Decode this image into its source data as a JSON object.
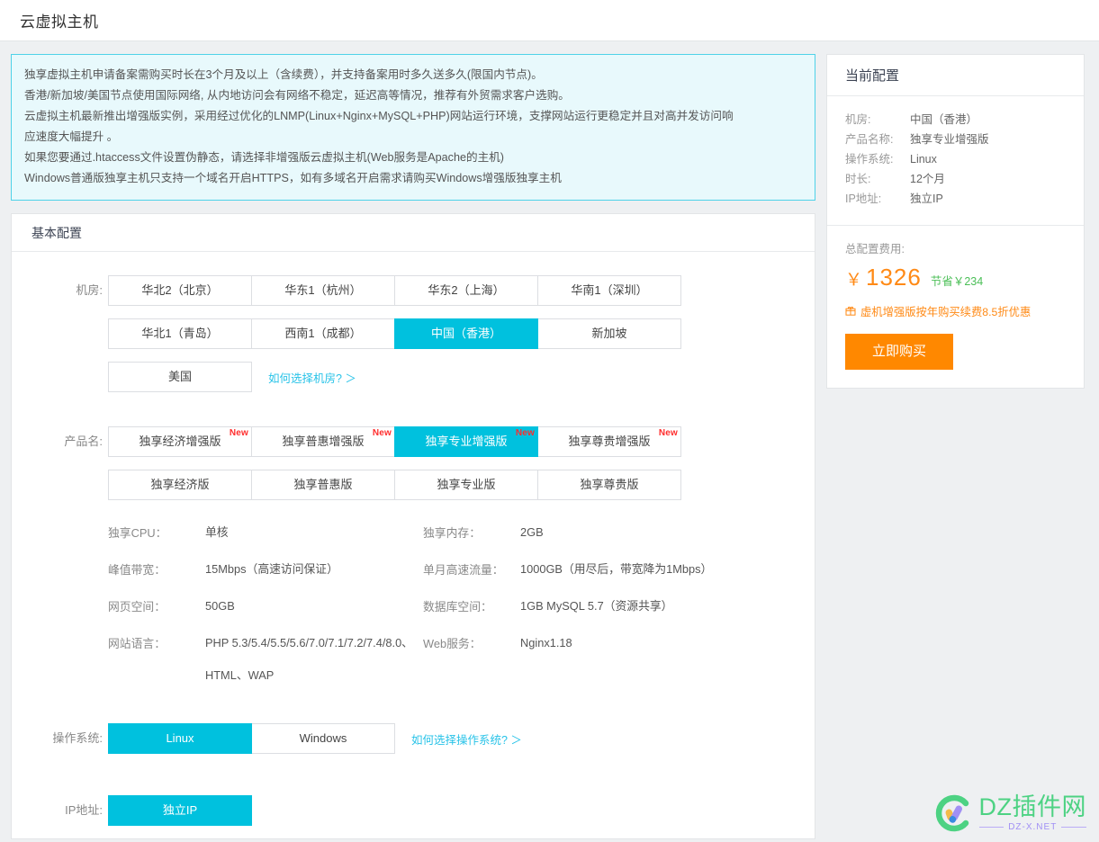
{
  "header": {
    "title": "云虚拟主机"
  },
  "notice": {
    "lines": [
      "独享虚拟主机申请备案需购买时长在3个月及以上（含续费），并支持备案用时多久送多久(限国内节点)。",
      "香港/新加坡/美国节点使用国际网络, 从内地访问会有网络不稳定，延迟高等情况，推荐有外贸需求客户选购。",
      "云虚拟主机最新推出增强版实例，采用经过优化的LNMP(Linux+Nginx+MySQL+PHP)网站运行环境，支撑网站运行更稳定并且对高并发访问响",
      "应速度大幅提升 。",
      "如果您要通过.htaccess文件设置伪静态，请选择非增强版云虚拟主机(Web服务是Apache的主机)",
      "Windows普通版独享主机只支持一个域名开启HTTPS，如有多域名开启需求请购买Windows增强版独享主机"
    ]
  },
  "basic_config": {
    "section_title": "基本配置",
    "room": {
      "label": "机房:",
      "rows": [
        [
          {
            "text": "华北2（北京）",
            "selected": false
          },
          {
            "text": "华东1（杭州）",
            "selected": false
          },
          {
            "text": "华东2（上海）",
            "selected": false
          },
          {
            "text": "华南1（深圳）",
            "selected": false
          }
        ],
        [
          {
            "text": "华北1（青岛）",
            "selected": false
          },
          {
            "text": "西南1（成都）",
            "selected": false
          },
          {
            "text": "中国（香港）",
            "selected": true
          },
          {
            "text": "新加坡",
            "selected": false
          }
        ],
        [
          {
            "text": "美国",
            "selected": false
          }
        ]
      ],
      "help_link": "如何选择机房? ＞"
    },
    "product": {
      "label": "产品名:",
      "badge_text": "New",
      "rows": [
        [
          {
            "text": "独享经济增强版",
            "selected": false,
            "badge": true
          },
          {
            "text": "独享普惠增强版",
            "selected": false,
            "badge": true
          },
          {
            "text": "独享专业增强版",
            "selected": true,
            "badge": true
          },
          {
            "text": "独享尊贵增强版",
            "selected": false,
            "badge": true
          }
        ],
        [
          {
            "text": "独享经济版",
            "selected": false,
            "badge": false
          },
          {
            "text": "独享普惠版",
            "selected": false,
            "badge": false
          },
          {
            "text": "独享专业版",
            "selected": false,
            "badge": false
          },
          {
            "text": "独享尊贵版",
            "selected": false,
            "badge": false
          }
        ]
      ]
    },
    "specs_left": [
      {
        "key": "独享CPU：",
        "value": "单核"
      },
      {
        "key": "峰值带宽：",
        "value": "15Mbps（高速访问保证）"
      },
      {
        "key": "网页空间：",
        "value": "50GB"
      },
      {
        "key": "网站语言：",
        "value": "PHP 5.3/5.4/5.5/5.6/7.0/7.1/7.2/7.4/8.0、",
        "value2": "HTML、WAP"
      }
    ],
    "specs_right": [
      {
        "key": "独享内存：",
        "value": "2GB"
      },
      {
        "key": "单月高速流量：",
        "value": "1000GB（用尽后，带宽降为1Mbps）"
      },
      {
        "key": "数据库空间：",
        "value": "1GB MySQL 5.7（资源共享）"
      },
      {
        "key": "Web服务：",
        "value": "Nginx1.18"
      }
    ],
    "os": {
      "label": "操作系统:",
      "options": [
        {
          "text": "Linux",
          "selected": true
        },
        {
          "text": "Windows",
          "selected": false
        }
      ],
      "help_link": "如何选择操作系统? ＞"
    },
    "ip": {
      "label": "IP地址:",
      "options": [
        {
          "text": "独立IP",
          "selected": true
        }
      ]
    }
  },
  "current_config": {
    "title": "当前配置",
    "rows": [
      {
        "key": "机房:",
        "value": "中国（香港）"
      },
      {
        "key": "产品名称:",
        "value": "独享专业增强版"
      },
      {
        "key": "操作系统:",
        "value": "Linux"
      },
      {
        "key": "时长:",
        "value": "12个月"
      },
      {
        "key": "IP地址:",
        "value": "独立IP"
      }
    ],
    "total_label": "总配置费用:",
    "currency": "￥",
    "price": "1326",
    "savings": "节省￥234",
    "promo_icon": "gift-icon",
    "promo_text": "虚机增强版按年购买续费8.5折优惠",
    "buy_label": "立即购买"
  },
  "watermark": {
    "main": "DZ插件网",
    "sub": "DZ-X.NET"
  },
  "colors": {
    "accent_cyan": "#00c1de",
    "buy_orange": "#ff8800",
    "price_orange": "#ff8a16",
    "savings_green": "#4bbf57",
    "badge_red": "#ff2d2d",
    "link_blue": "#29c3e8"
  }
}
